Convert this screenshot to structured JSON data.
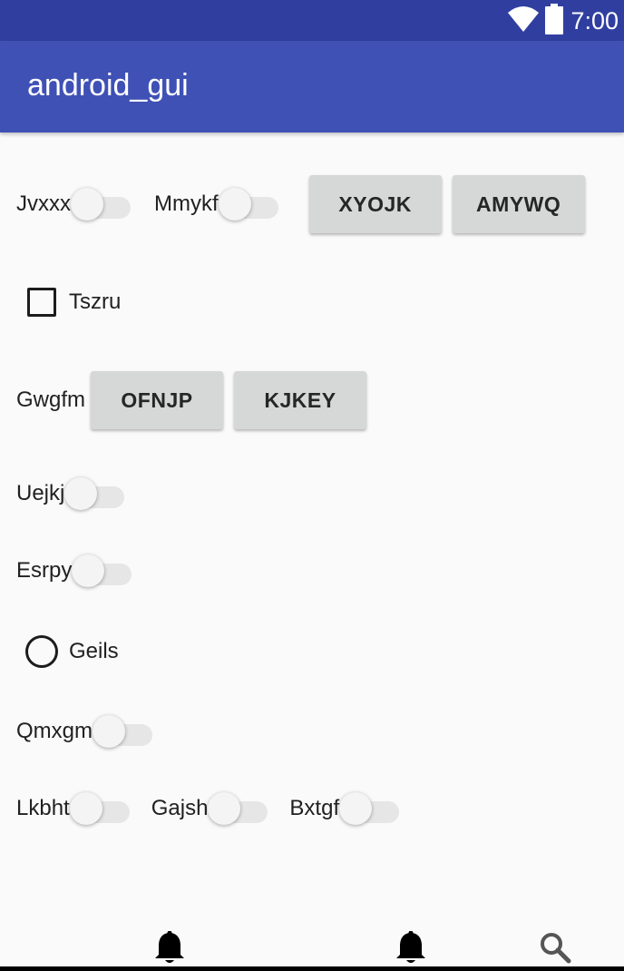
{
  "status_bar": {
    "time": "7:00",
    "icons": [
      "wifi-icon",
      "battery-icon"
    ],
    "color": "#303f9f"
  },
  "app_bar": {
    "title": "android_gui",
    "color": "#3f51b5"
  },
  "rows": {
    "r1": {
      "switch1_label": "Jvxxx",
      "switch2_label": "Mmykf",
      "button1": "XYOJK",
      "button2": "AMYWQ"
    },
    "r2": {
      "checkbox_label": "Tszru",
      "checked": false
    },
    "r3": {
      "label": "Gwgfm",
      "button1": "OFNJP",
      "button2": "KJKEY"
    },
    "r4": {
      "switch_label": "Uejkj"
    },
    "r5": {
      "switch_label": "Esrpy"
    },
    "r6": {
      "radio_label": "Geils",
      "selected": false
    },
    "r7": {
      "switch_label": "Qmxgm"
    },
    "r8": {
      "switch1_label": "Lkbht",
      "switch2_label": "Gajsh",
      "switch3_label": "Bxtgf"
    }
  },
  "bottom_nav": {
    "icons": [
      "bell-icon",
      "bell-icon",
      "search-icon"
    ]
  }
}
